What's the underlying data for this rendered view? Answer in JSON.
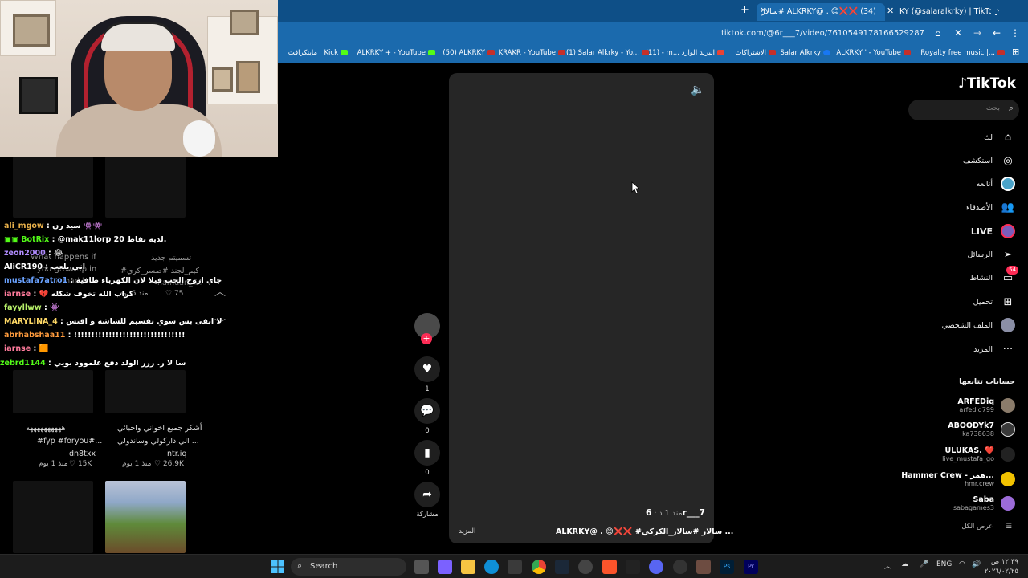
{
  "browser": {
    "tabs": [
      {
        "title": "KY (@salaralkrky) | TikTok(+99)"
      },
      {
        "title": "سالار# ALKRKY@ . 😊❌❌ (34)",
        "active": true
      }
    ],
    "new_tab_symbol": "+",
    "url": "tiktok.com/@6r___7/video/7610549178166529287",
    "bookmarks": [
      "ماينكرافت",
      "Kick",
      "ALKRKY + - YouTube",
      "(50) ALKRKY",
      "KRAKR - YouTube",
      "(1) Salar Alkrky - Yo...",
      "(11) - m... البريد الوارد",
      "الاشتراكات",
      "Salar Alkrky",
      "ALKRKY ' - YouTube",
      "Royalty free music |..."
    ]
  },
  "chat": [
    {
      "user": "ali_mgow",
      "color": "#e8b04a",
      "msg": "سيد رن 👾👾"
    },
    {
      "user": "BotRix",
      "color": "#53fc18",
      "msg": "@mak11lorp 20 لديه نقاط."
    },
    {
      "user": "zeon2000",
      "color": "#b18cff",
      "msg": "😂"
    },
    {
      "user": "AliCR190",
      "color": "#ffffff",
      "msg": "اني بلعب"
    },
    {
      "user": "mustafa7atro1",
      "color": "#6aa2ff",
      "msg": "جاي اروح الحب فيلا لان الكهرباء طافية"
    },
    {
      "user": "iarnse",
      "color": "#ff7b9c",
      "msg": "💔 كراب الله تخوف شكله"
    },
    {
      "user": "fayyllww",
      "color": "#b7f06a",
      "msg": "👾"
    },
    {
      "user": "MARYLINA_4",
      "color": "#ffd966",
      "msg": "لا ابقى بس سوي تقسيم للشاشه و اقتس"
    },
    {
      "user": "abrhabshaa11",
      "color": "#ff9b3d",
      "msg": "!!!!!!!!!!!!!!!!!!!!!!!!!!!!!!!!!!!!!!!!!!!!!!!!!!!!!!!!!!"
    },
    {
      "user": "iarnse",
      "color": "#ff7b9c",
      "msg": "🟧"
    },
    {
      "user": "zebrd1144",
      "color": "#53fc18",
      "msg": "سا لا ر. ررر الولد دفع علموود بويي"
    }
  ],
  "left_grid": {
    "tile_a": {
      "title": "What happens if",
      "title2": "you grow up in",
      "author": "ahmad.ko...",
      "likes": "75",
      "date": "منذ 6 يوم",
      "side_text": "تسميتم جديد",
      "side_text2": "#كيم_لجند #صسر_كري",
      "side_author": "hamdan_64"
    },
    "tile_b": {
      "title": "#fyp #foryou#...",
      "title_prefix": "ههههههههههه",
      "author": "dn8txx",
      "likes": "15K",
      "date": "منذ 1 يوم"
    },
    "tile_c": {
      "title": "أشكر جميع اخواني واحبائي",
      "title2": "الي داركولي وساندولي ...",
      "author": "ntr.iq",
      "likes": "26.9K",
      "date": "منذ 1 يوم"
    }
  },
  "video": {
    "author": "6r___7",
    "time_ago": "منذ 1 د",
    "caption": "ALKRKY@ . 😊❌❌ #سالار #سالار_الكركي ...",
    "more": "المزيد",
    "likes": "1",
    "comments": "0",
    "saves": "0",
    "share_label": "مشاركة"
  },
  "tiktok": {
    "logo": "TikTok",
    "search_placeholder": "بحث",
    "nav": [
      {
        "label": "لك",
        "icon": "home-icon"
      },
      {
        "label": "استكشف",
        "icon": "compass-icon"
      },
      {
        "label": "أتابعه",
        "icon": "following-icon"
      },
      {
        "label": "الأصدقاء",
        "icon": "friends-icon"
      },
      {
        "label": "LIVE",
        "icon": "live-icon"
      },
      {
        "label": "الرسائل",
        "icon": "send-icon"
      },
      {
        "label": "النشاط",
        "icon": "activity-icon",
        "badge": "54"
      },
      {
        "label": "تحميل",
        "icon": "upload-icon"
      },
      {
        "label": "الملف الشخصي",
        "icon": "profile-icon"
      },
      {
        "label": "المزيد",
        "icon": "more-icon"
      }
    ],
    "following_title": "حسابات تتابعها",
    "accounts": [
      {
        "name": "ARFEDiq",
        "handle": "arfediq799",
        "color": "#8a7b6a"
      },
      {
        "name": "ABOODYk7",
        "handle": "ka738638",
        "color": "#3a3a3a"
      },
      {
        "name": "ULUKAS. ❤️",
        "handle": "live_mustafa_go",
        "color": "#222"
      },
      {
        "name": "Hammer Crew - همر...",
        "handle": "hmr.crew",
        "color": "#f2c200"
      },
      {
        "name": "Saba",
        "handle": "sabagames3",
        "color": "#9c6bd8"
      }
    ],
    "see_all": "عرض الكل"
  },
  "taskbar": {
    "search_label": "Search",
    "lang": "ENG",
    "time": "١٢:٣٩ ص",
    "date": "٢٠٢٦/٠٢/٢٥"
  }
}
